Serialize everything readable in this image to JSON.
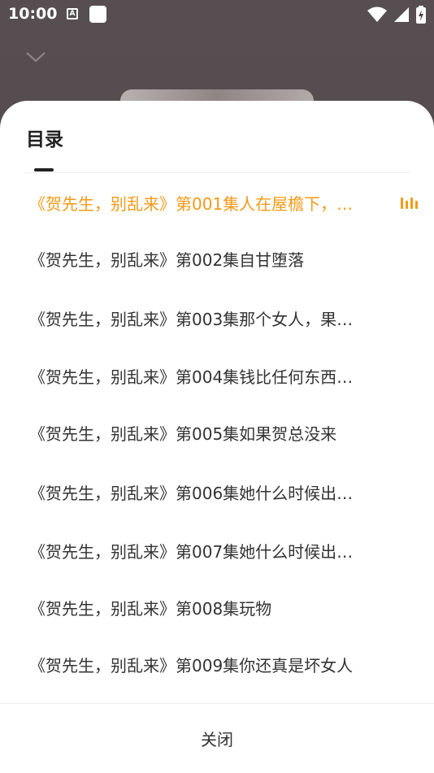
{
  "status_bar": {
    "time": "10:00",
    "notification_a": "A",
    "icons": [
      "wifi-icon",
      "signal-icon",
      "battery-icon"
    ]
  },
  "player": {
    "collapse_icon": "chevron-down-icon"
  },
  "sheet": {
    "title": "目录",
    "accent_color": "#f29a17",
    "episodes": [
      {
        "title": "《贺先生，别乱来》第001集人在屋檐下，…",
        "active": true
      },
      {
        "title": "《贺先生，别乱来》第002集自甘堕落",
        "active": false
      },
      {
        "title": "《贺先生，别乱来》第003集那个女人，果…",
        "active": false
      },
      {
        "title": "《贺先生，别乱来》第004集钱比任何东西…",
        "active": false
      },
      {
        "title": "《贺先生，别乱来》第005集如果贺总没来",
        "active": false
      },
      {
        "title": "《贺先生，别乱来》第006集她什么时候出…",
        "active": false
      },
      {
        "title": "《贺先生，别乱来》第007集她什么时候出…",
        "active": false
      },
      {
        "title": "《贺先生，别乱来》第008集玩物",
        "active": false
      },
      {
        "title": "《贺先生，别乱来》第009集你还真是坏女人",
        "active": false
      }
    ],
    "close_label": "关闭"
  }
}
